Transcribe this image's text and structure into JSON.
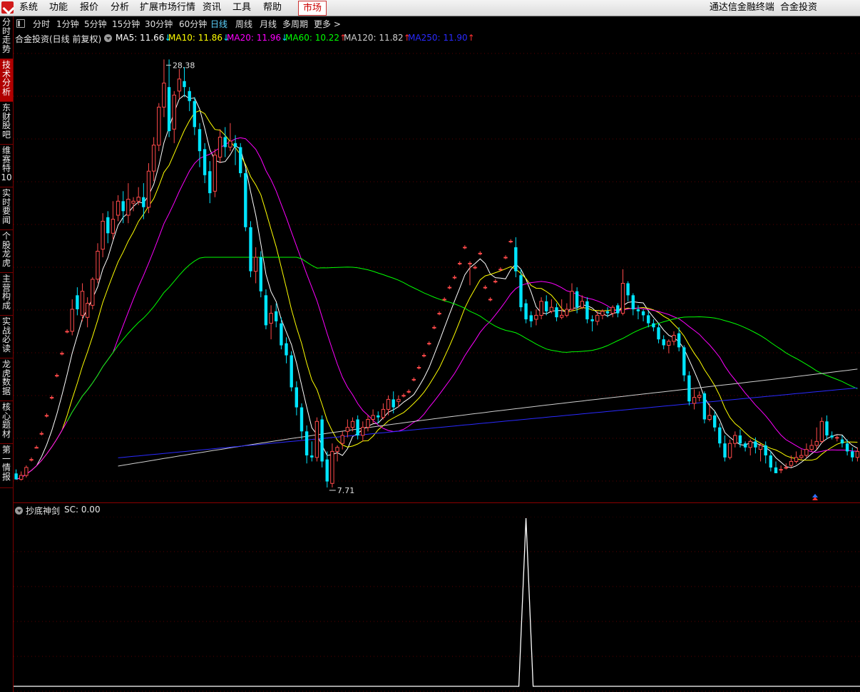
{
  "menubar": {
    "items": [
      "系统",
      "功能",
      "报价",
      "分析",
      "扩展市场行情",
      "资讯",
      "工具",
      "帮助"
    ],
    "active_tab": "市场",
    "title": "通达信金融终端",
    "stock_name": "合金投资"
  },
  "sidebar": {
    "tabs": [
      "分时走势",
      "技术分析",
      "东财股吧",
      "维赛特10",
      "实时要闻",
      "个股龙虎",
      "主营构成",
      "实战必读",
      "龙虎数据",
      "核心题材",
      "第一情报"
    ],
    "selected": 1
  },
  "periods": {
    "items": [
      "分时",
      "1分钟",
      "5分钟",
      "15分钟",
      "30分钟",
      "60分钟",
      "日线",
      "周线",
      "月线",
      "多周期",
      "更多 >"
    ],
    "selected": 6
  },
  "chart_header": {
    "title": "合金投资(日线 前复权)",
    "ma": [
      {
        "label": "MA5: 11.66",
        "arrow": "↓",
        "color": "#ffffff",
        "arrow_color": "#00e5ff"
      },
      {
        "label": "MA10: 11.86",
        "arrow": "↓",
        "color": "#ffff00",
        "arrow_color": "#00e5ff"
      },
      {
        "label": "MA20: 11.96",
        "arrow": "↓",
        "color": "#ff00ff",
        "arrow_color": "#00e5ff"
      },
      {
        "label": "MA60: 10.22",
        "arrow": "↑",
        "color": "#00ff00",
        "arrow_color": "#ff3030"
      },
      {
        "label": "MA120: 11.82",
        "arrow": "↑",
        "color": "#cfcfcf",
        "arrow_color": "#ff3030"
      },
      {
        "label": "MA250: 11.90",
        "arrow": "↑",
        "color": "#2a2aff",
        "arrow_color": "#ff3030"
      }
    ]
  },
  "indicator": {
    "name": "抄底神剑",
    "value_label": "SC: 0.00",
    "signals": [
      100,
      190,
      210
    ]
  },
  "chart_data": {
    "type": "candlestick",
    "high_label": "28.38",
    "low_label": "7.71",
    "y_range": [
      7.0,
      29.0
    ],
    "colors": {
      "up": "#ff4a4a",
      "down": "#00e5ff"
    },
    "candles": [
      [
        7.7,
        7.4,
        7.9,
        7.6
      ],
      [
        7.4,
        7.6,
        7.8,
        7.35
      ],
      [
        7.6,
        8.0,
        8.1,
        7.5
      ],
      [
        8.4,
        8.4,
        8.5,
        8.3
      ],
      [
        9.0,
        9.0,
        9.1,
        8.95
      ],
      [
        9.7,
        9.7,
        9.8,
        9.6
      ],
      [
        10.6,
        10.6,
        10.7,
        10.5
      ],
      [
        11.5,
        11.5,
        11.6,
        11.4
      ],
      [
        12.6,
        12.6,
        12.7,
        12.5
      ],
      [
        13.7,
        13.7,
        13.8,
        13.6
      ],
      [
        14.8,
        14.8,
        14.9,
        14.7
      ],
      [
        14.8,
        15.9,
        16.4,
        14.6
      ],
      [
        16.6,
        15.9,
        17.0,
        15.6
      ],
      [
        15.6,
        16.8,
        17.2,
        15.3
      ],
      [
        15.5,
        16.2,
        16.5,
        15.0
      ],
      [
        16.1,
        17.4,
        17.5,
        15.9
      ],
      [
        17.4,
        18.8,
        19.2,
        17.2
      ],
      [
        18.9,
        20.3,
        20.7,
        18.5
      ],
      [
        20.5,
        19.7,
        20.8,
        19.2
      ],
      [
        19.7,
        20.4,
        21.3,
        19.4
      ],
      [
        20.6,
        21.3,
        21.6,
        20.3
      ],
      [
        21.3,
        20.8,
        21.8,
        20.2
      ],
      [
        20.6,
        21.4,
        22.2,
        20.2
      ],
      [
        21.2,
        21.3,
        21.5,
        20.8
      ],
      [
        21.3,
        21.5,
        22.0,
        21.1
      ],
      [
        21.5,
        21.0,
        22.2,
        20.4
      ],
      [
        21.0,
        22.8,
        23.2,
        20.7
      ],
      [
        22.8,
        24.1,
        24.5,
        22.3
      ],
      [
        24.1,
        26.0,
        26.2,
        23.8
      ],
      [
        26.0,
        27.2,
        28.38,
        25.5
      ],
      [
        27.0,
        24.8,
        28.38,
        24.5
      ],
      [
        24.9,
        26.6,
        26.8,
        24.2
      ],
      [
        26.8,
        27.4,
        27.9,
        26.4
      ],
      [
        27.3,
        27.0,
        28.0,
        26.5
      ],
      [
        26.8,
        26.3,
        27.0,
        25.8
      ],
      [
        26.3,
        25.0,
        26.5,
        24.6
      ],
      [
        24.9,
        23.8,
        25.2,
        23.0
      ],
      [
        23.9,
        22.6,
        24.2,
        22.2
      ],
      [
        22.8,
        21.7,
        23.3,
        21.2
      ],
      [
        21.8,
        23.6,
        23.9,
        21.5
      ],
      [
        23.5,
        24.5,
        24.9,
        23.2
      ],
      [
        24.5,
        24.0,
        25.0,
        23.5
      ],
      [
        24.0,
        24.3,
        25.2,
        23.8
      ],
      [
        24.2,
        24.0,
        24.6,
        23.1
      ],
      [
        24.0,
        22.7,
        24.2,
        22.5
      ],
      [
        22.7,
        20.0,
        22.9,
        19.8
      ],
      [
        20.0,
        17.8,
        20.3,
        17.5
      ],
      [
        17.8,
        18.5,
        19.0,
        17.2
      ],
      [
        18.5,
        16.8,
        18.8,
        16.5
      ],
      [
        16.6,
        15.1,
        16.9,
        14.9
      ],
      [
        15.2,
        15.7,
        16.1,
        14.4
      ],
      [
        15.8,
        15.3,
        16.2,
        15.0
      ],
      [
        15.2,
        14.1,
        15.5,
        13.9
      ],
      [
        14.2,
        13.6,
        14.5,
        13.2
      ],
      [
        13.6,
        12.0,
        13.8,
        11.8
      ],
      [
        12.0,
        11.0,
        12.3,
        10.6
      ],
      [
        11.0,
        9.8,
        11.2,
        9.4
      ],
      [
        9.8,
        8.6,
        10.1,
        8.2
      ],
      [
        8.6,
        8.5,
        9.3,
        8.3
      ],
      [
        8.5,
        10.3,
        10.5,
        8.3
      ],
      [
        10.4,
        8.3,
        10.6,
        8.0
      ],
      [
        8.4,
        7.3,
        8.8,
        7.0
      ],
      [
        7.2,
        8.8,
        9.2,
        7.0
      ],
      [
        8.8,
        9.0,
        9.1,
        8.3
      ],
      [
        9.2,
        9.6,
        9.8,
        8.9
      ],
      [
        9.8,
        10.0,
        10.4,
        9.5
      ],
      [
        10.0,
        10.3,
        10.5,
        9.8
      ],
      [
        10.4,
        9.6,
        10.6,
        9.4
      ],
      [
        9.6,
        10.0,
        10.3,
        9.3
      ],
      [
        10.0,
        10.4,
        10.6,
        9.8
      ],
      [
        10.4,
        10.6,
        10.9,
        10.2
      ],
      [
        10.6,
        10.5,
        10.8,
        10.2
      ],
      [
        10.5,
        10.9,
        11.2,
        10.4
      ],
      [
        10.9,
        11.4,
        11.6,
        10.6
      ],
      [
        11.4,
        11.0,
        11.8,
        10.7
      ],
      [
        11.3,
        11.4,
        11.6,
        11.0
      ],
      [
        11.6,
        11.6,
        11.7,
        11.5
      ],
      [
        11.8,
        11.8,
        11.9,
        11.7
      ],
      [
        12.4,
        12.4,
        12.5,
        12.3
      ],
      [
        13.0,
        13.0,
        13.1,
        12.9
      ],
      [
        13.6,
        13.6,
        13.7,
        13.5
      ],
      [
        14.2,
        14.2,
        14.3,
        14.1
      ],
      [
        15.0,
        15.0,
        15.1,
        14.9
      ],
      [
        15.7,
        15.7,
        15.8,
        15.6
      ],
      [
        16.4,
        16.4,
        16.5,
        16.3
      ],
      [
        17.0,
        17.0,
        17.1,
        16.9
      ],
      [
        17.5,
        17.5,
        17.6,
        17.4
      ],
      [
        18.2,
        18.2,
        18.3,
        18.1
      ],
      [
        19.0,
        19.0,
        19.1,
        18.9
      ],
      [
        18.2,
        18.2,
        18.3,
        17.1
      ],
      [
        18.0,
        18.0,
        18.1,
        17.9
      ],
      [
        18.7,
        18.7,
        18.8,
        18.6
      ],
      [
        17.0,
        17.0,
        17.1,
        16.9
      ],
      [
        16.4,
        16.4,
        16.5,
        16.3
      ],
      [
        17.3,
        17.3,
        17.4,
        17.2
      ],
      [
        17.9,
        17.9,
        18.0,
        17.8
      ],
      [
        18.5,
        18.5,
        18.6,
        18.4
      ],
      [
        19.3,
        19.3,
        19.4,
        19.2
      ],
      [
        19.0,
        17.8,
        19.5,
        17.5
      ],
      [
        17.6,
        16.0,
        17.9,
        15.8
      ],
      [
        16.2,
        15.4,
        16.4,
        15.2
      ],
      [
        15.6,
        15.3,
        15.8,
        15.0
      ],
      [
        15.4,
        15.6,
        15.9,
        15.1
      ],
      [
        15.6,
        16.3,
        16.5,
        15.4
      ],
      [
        16.3,
        15.8,
        16.6,
        15.6
      ],
      [
        15.8,
        16.0,
        16.4,
        15.7
      ],
      [
        16.0,
        15.5,
        16.2,
        15.3
      ],
      [
        15.5,
        15.6,
        16.4,
        15.4
      ],
      [
        15.6,
        15.9,
        16.2,
        15.5
      ],
      [
        15.9,
        16.8,
        17.2,
        15.8
      ],
      [
        16.8,
        16.0,
        17.0,
        15.7
      ],
      [
        16.0,
        16.3,
        16.6,
        15.9
      ],
      [
        16.3,
        15.4,
        16.5,
        15.2
      ],
      [
        15.4,
        15.3,
        15.6,
        14.8
      ],
      [
        15.3,
        15.6,
        15.8,
        15.1
      ],
      [
        15.6,
        15.8,
        15.9,
        15.4
      ],
      [
        15.8,
        15.7,
        16.0,
        15.5
      ],
      [
        15.7,
        16.0,
        16.1,
        15.5
      ],
      [
        16.1,
        15.7,
        16.2,
        15.5
      ],
      [
        15.7,
        17.2,
        17.9,
        15.6
      ],
      [
        17.2,
        16.6,
        17.3,
        16.3
      ],
      [
        16.6,
        15.9,
        16.7,
        15.6
      ],
      [
        15.9,
        15.8,
        16.1,
        15.4
      ],
      [
        15.8,
        15.6,
        15.9,
        15.3
      ],
      [
        15.6,
        15.2,
        15.8,
        15.0
      ],
      [
        15.2,
        15.0,
        15.4,
        14.8
      ],
      [
        15.0,
        14.4,
        15.2,
        14.2
      ],
      [
        14.4,
        14.1,
        14.6,
        13.9
      ],
      [
        14.1,
        14.3,
        14.4,
        13.7
      ],
      [
        14.3,
        14.6,
        14.8,
        14.1
      ],
      [
        14.7,
        14.0,
        15.0,
        13.8
      ],
      [
        14.0,
        12.6,
        14.1,
        12.3
      ],
      [
        12.6,
        11.3,
        12.8,
        11.1
      ],
      [
        11.2,
        11.5,
        11.9,
        10.9
      ],
      [
        11.5,
        11.6,
        11.8,
        11.3
      ],
      [
        11.7,
        10.4,
        11.8,
        10.2
      ],
      [
        10.4,
        10.6,
        11.2,
        10.3
      ],
      [
        10.6,
        10.0,
        10.8,
        9.8
      ],
      [
        10.0,
        9.2,
        10.2,
        9.0
      ],
      [
        9.2,
        8.5,
        9.6,
        8.3
      ],
      [
        8.5,
        9.2,
        9.4,
        8.4
      ],
      [
        9.2,
        9.6,
        9.8,
        9.0
      ],
      [
        9.6,
        9.2,
        9.9,
        9.0
      ],
      [
        9.2,
        9.0,
        9.3,
        8.8
      ],
      [
        9.0,
        9.3,
        9.4,
        8.6
      ],
      [
        9.3,
        9.0,
        9.5,
        8.7
      ],
      [
        8.9,
        9.1,
        9.2,
        8.3
      ],
      [
        9.1,
        8.6,
        9.3,
        8.2
      ],
      [
        8.6,
        8.0,
        8.8,
        7.8
      ],
      [
        8.0,
        7.71,
        8.3,
        7.71
      ],
      [
        7.9,
        7.9,
        8.1,
        7.71
      ],
      [
        8.0,
        8.0,
        8.2,
        7.9
      ],
      [
        8.1,
        8.3,
        8.6,
        8.0
      ],
      [
        8.3,
        8.5,
        8.8,
        8.2
      ],
      [
        8.5,
        8.6,
        8.9,
        8.4
      ],
      [
        8.6,
        8.9,
        9.2,
        8.5
      ],
      [
        8.9,
        9.1,
        9.4,
        8.8
      ],
      [
        9.1,
        9.3,
        10.0,
        8.9
      ],
      [
        9.3,
        10.3,
        10.5,
        9.2
      ],
      [
        10.3,
        9.6,
        10.6,
        9.4
      ],
      [
        9.6,
        9.5,
        9.8,
        9.4
      ],
      [
        9.5,
        9.5,
        9.6,
        9.3
      ],
      [
        9.4,
        9.2,
        9.6,
        9.0
      ],
      [
        9.2,
        8.8,
        9.4,
        8.6
      ],
      [
        8.8,
        8.5,
        9.0,
        8.3
      ],
      [
        8.5,
        8.8,
        9.0,
        8.3
      ]
    ]
  }
}
